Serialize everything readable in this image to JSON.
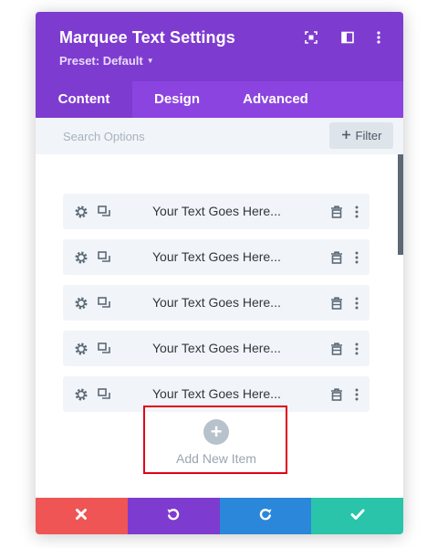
{
  "header": {
    "title": "Marquee Text Settings",
    "preset_label": "Preset: Default",
    "icons": [
      "fullscreen-icon",
      "sidebar-toggle-icon",
      "more-vertical-icon"
    ]
  },
  "tabs": [
    {
      "label": "Content",
      "active": true
    },
    {
      "label": "Design",
      "active": false
    },
    {
      "label": "Advanced",
      "active": false
    }
  ],
  "search": {
    "placeholder": "Search Options",
    "filter_label": "Filter"
  },
  "items": [
    {
      "label": "Your Text Goes Here..."
    },
    {
      "label": "Your Text Goes Here..."
    },
    {
      "label": "Your Text Goes Here..."
    },
    {
      "label": "Your Text Goes Here..."
    },
    {
      "label": "Your Text Goes Here..."
    }
  ],
  "add_item": {
    "label": "Add New Item"
  },
  "footer": [
    {
      "action": "discard",
      "icon": "close-icon",
      "color": "#ef5555"
    },
    {
      "action": "undo",
      "icon": "undo-icon",
      "color": "#7e3bd0"
    },
    {
      "action": "redo",
      "icon": "redo-icon",
      "color": "#2b87da"
    },
    {
      "action": "save",
      "icon": "check-icon",
      "color": "#29c4a9"
    }
  ],
  "colors": {
    "header": "#7e3bd0",
    "tabs": "#8c44e0",
    "highlight": "#e0001b"
  }
}
